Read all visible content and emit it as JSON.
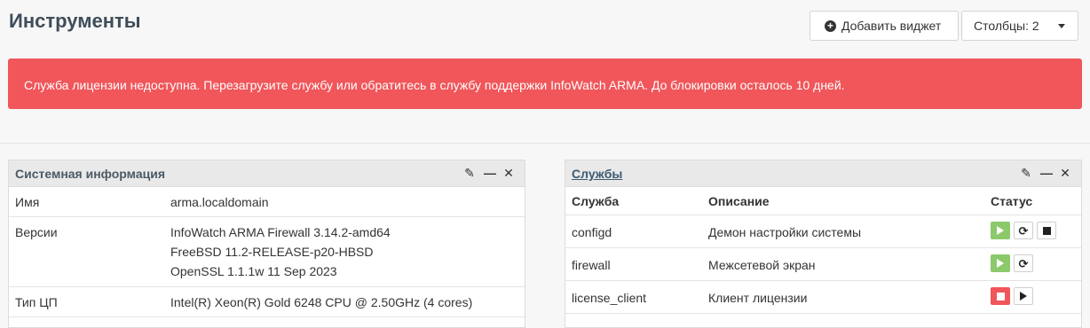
{
  "header": {
    "title": "Инструменты",
    "add_widget_label": "Добавить виджет",
    "columns_label": "Столбцы: 2"
  },
  "alert": {
    "text": "Служба лицензии недоступна. Перезагрузите службу или обратитесь в службу поддержки InfoWatch ARMA. До блокировки осталось 10 дней."
  },
  "sysinfo": {
    "title": "Системная информация",
    "rows": [
      {
        "key": "Имя",
        "values": [
          "arma.localdomain"
        ]
      },
      {
        "key": "Версии",
        "values": [
          "InfoWatch ARMA Firewall 3.14.2-amd64",
          "FreeBSD 11.2-RELEASE-p20-HBSD",
          "OpenSSL 1.1.1w 11 Sep 2023"
        ]
      },
      {
        "key": "Тип ЦП",
        "values": [
          "Intel(R) Xeon(R) Gold 6248 CPU @ 2.50GHz (4 cores)"
        ]
      }
    ]
  },
  "services": {
    "title": "Службы",
    "columns": [
      "Служба",
      "Описание",
      "Статус"
    ],
    "rows": [
      {
        "name": "configd",
        "description": "Демон настройки системы",
        "status": "running"
      },
      {
        "name": "firewall",
        "description": "Межсетевой экран",
        "status": "running"
      },
      {
        "name": "license_client",
        "description": "Клиент лицензии",
        "status": "stopped"
      }
    ]
  },
  "colors": {
    "alert": "#f0565a",
    "running": "#8cc96b",
    "stopped": "#f0565a"
  },
  "icons": [
    "plus-circle-icon",
    "chevron-down-icon",
    "pencil-icon",
    "minimize-icon",
    "close-icon",
    "play-icon",
    "reload-icon",
    "stop-icon"
  ]
}
